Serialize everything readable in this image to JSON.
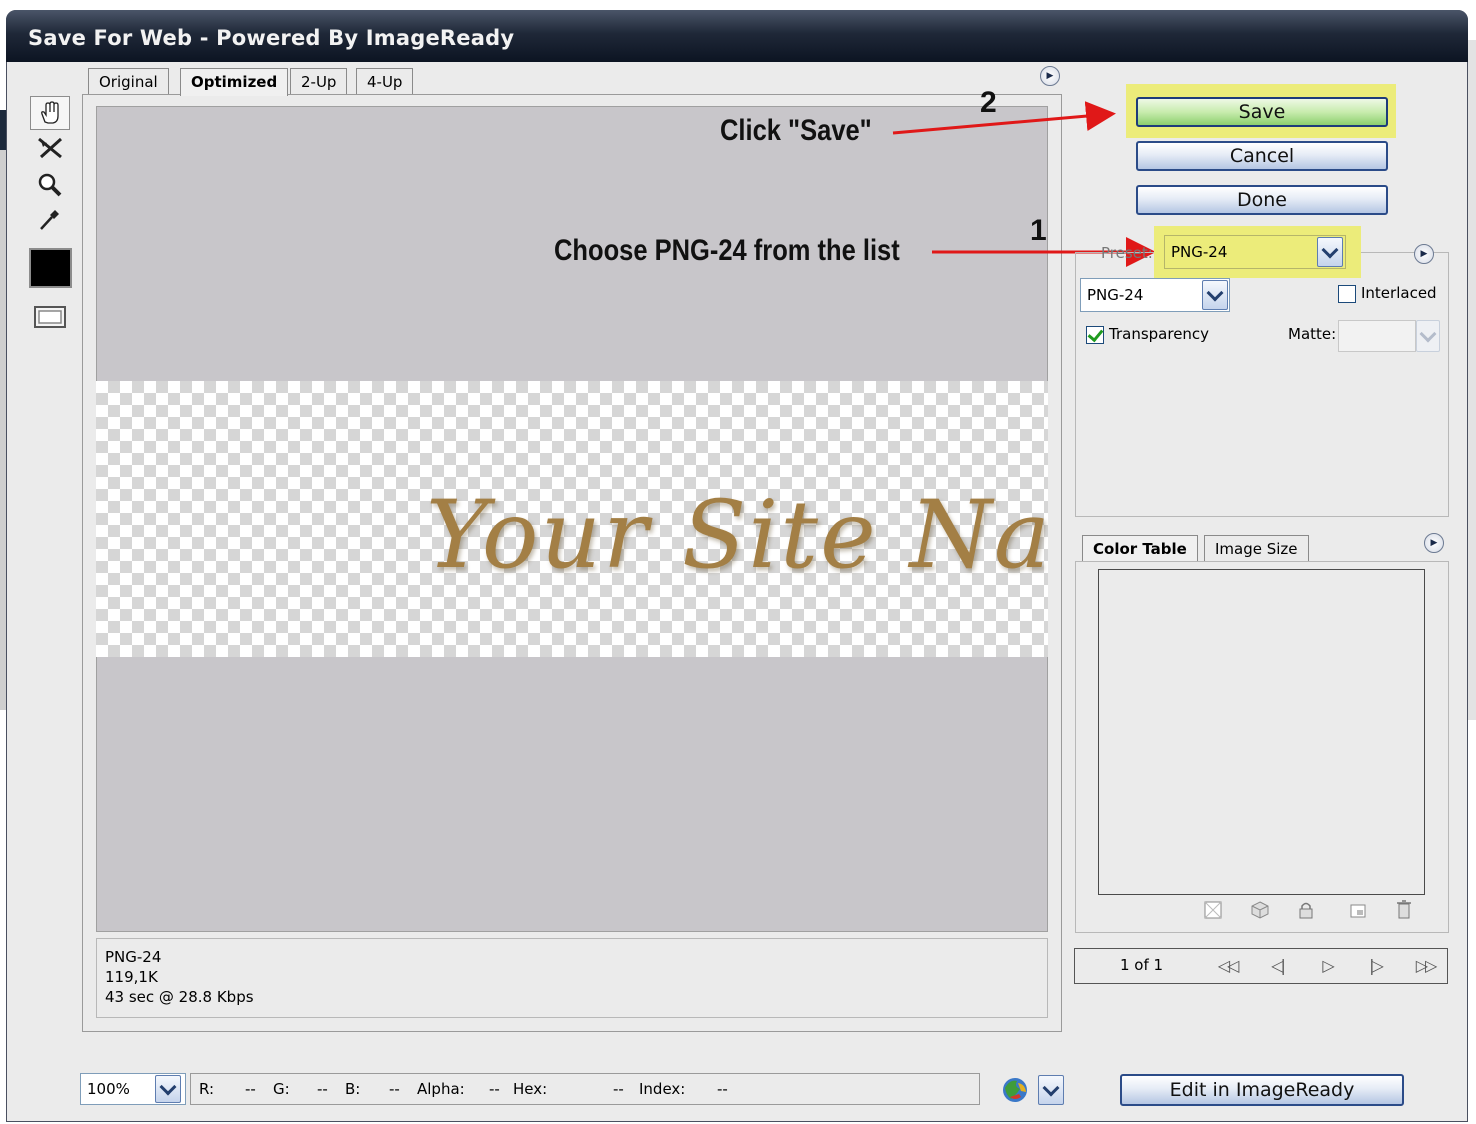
{
  "window": {
    "title": "Save For Web - Powered By ImageReady"
  },
  "tabs": [
    "Original",
    "Optimized",
    "2-Up",
    "4-Up"
  ],
  "canvas": {
    "preview_text": "Your Site Nam"
  },
  "info": {
    "format": "PNG-24",
    "size": "119,1K",
    "download_time": "43 sec @ 28.8 Kbps"
  },
  "annotations": {
    "step2_number": "2",
    "step2_text": "Click \"Save\"",
    "step1_number": "1",
    "step1_text": "Choose PNG-24 from the list"
  },
  "buttons": {
    "save": "Save",
    "cancel": "Cancel",
    "done": "Done",
    "edit_in_imageready": "Edit in ImageReady"
  },
  "settings": {
    "preset_label": "Preset:",
    "preset_value": "PNG-24",
    "format_value": "PNG-24",
    "interlaced_label": "Interlaced",
    "interlaced_checked": false,
    "transparency_label": "Transparency",
    "transparency_checked": true,
    "matte_label": "Matte:"
  },
  "color_table": {
    "tabs": [
      "Color Table",
      "Image Size"
    ],
    "page_indicator": "1 of 1"
  },
  "status_bar": {
    "zoom": "100%",
    "r_label": "R:",
    "r_value": "--",
    "g_label": "G:",
    "g_value": "--",
    "b_label": "B:",
    "b_value": "--",
    "alpha_label": "Alpha:",
    "alpha_value": "--",
    "hex_label": "Hex:",
    "hex_value": "--",
    "index_label": "Index:",
    "index_value": "--"
  },
  "colors": {
    "title_bar": "#1f2838",
    "highlight": "#ecec7a",
    "save_button": "#8dcf6e",
    "arrow": "#e01818",
    "text_gold": "#a37f45"
  },
  "icons": [
    "hand-tool-icon",
    "slice-select-tool-icon",
    "zoom-tool-icon",
    "eyedropper-tool-icon",
    "eyedropper-color-swatch",
    "toggle-slices-icon",
    "menu-arrow-icon",
    "preview-browser-icon",
    "map-to-transparent-icon",
    "web-shift-icon",
    "lock-color-icon",
    "new-color-icon",
    "delete-color-icon"
  ]
}
